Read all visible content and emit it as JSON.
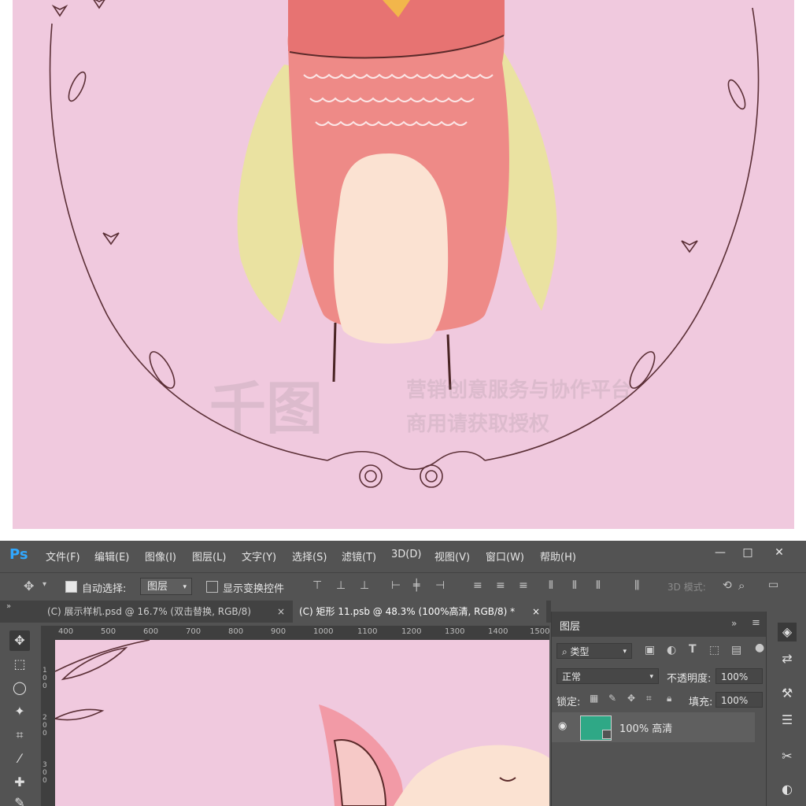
{
  "watermark": {
    "brand": "千图",
    "line1": "营销创意服务与协作平台",
    "line2": "商用请获取授权"
  },
  "app": {
    "logo": "Ps",
    "menu": [
      "文件(F)",
      "编辑(E)",
      "图像(I)",
      "图层(L)",
      "文字(Y)",
      "选择(S)",
      "滤镜(T)",
      "3D(D)",
      "视图(V)",
      "窗口(W)",
      "帮助(H)"
    ],
    "window_buttons": {
      "minimize": "—",
      "maximize": "□",
      "close": "✕"
    }
  },
  "options_bar": {
    "auto_select_label": "自动选择:",
    "auto_select_value": "图层",
    "show_transform_label": "显示变换控件",
    "mode_3d_label": "3D 模式:"
  },
  "tabs": [
    {
      "label": "(C) 展示样机.psd @ 16.7% (双击替换, RGB/8)",
      "close": "×"
    },
    {
      "label": "(C) 矩形 11.psb @ 48.3% (100%高清, RGB/8) *",
      "close": "×"
    }
  ],
  "ruler": {
    "h_ticks": [
      "400",
      "500",
      "600",
      "700",
      "800",
      "900",
      "1000",
      "1100",
      "1200",
      "1300",
      "1400",
      "1500"
    ],
    "v_ticks": [
      "100",
      "200",
      "300"
    ]
  },
  "layers_panel": {
    "title": "图层",
    "filter_label": "类型",
    "blend_mode": "正常",
    "opacity_label": "不透明度:",
    "opacity_value": "100%",
    "lock_label": "锁定:",
    "fill_label": "填充:",
    "fill_value": "100%",
    "layer_name": "100% 高清",
    "layer_thumb_color": "#2fa886"
  },
  "colors": {
    "canvas_pink": "#f0c9de",
    "ps_dark": "#535353",
    "ps_accent": "#31a8ff"
  }
}
